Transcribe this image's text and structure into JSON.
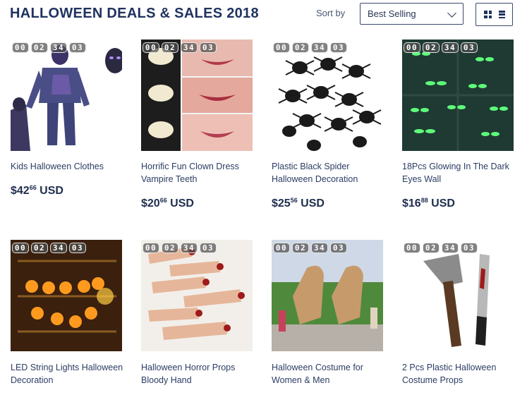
{
  "page": {
    "title": "HALLOWEEN DEALS & SALES 2018"
  },
  "sort": {
    "label": "Sort by",
    "selected": "Best Selling"
  },
  "icons": {
    "grid": "grid-view-icon",
    "list": "list-view-icon",
    "chevron": "chevron-down-icon"
  },
  "products": [
    {
      "name": "Kids Halloween Clothes",
      "price_whole": "$42",
      "price_cents": "66",
      "currency": "USD",
      "timer": [
        "00",
        "02",
        "34",
        "03"
      ],
      "image": "costume-image"
    },
    {
      "name": "Horrific Fun Clown Dress Vampire Teeth",
      "price_whole": "$20",
      "price_cents": "66",
      "currency": "USD",
      "timer": [
        "00",
        "02",
        "34",
        "03"
      ],
      "image": "vampire-teeth-image"
    },
    {
      "name": "Plastic Black Spider Halloween Decoration",
      "price_whole": "$25",
      "price_cents": "56",
      "currency": "USD",
      "timer": [
        "00",
        "02",
        "34",
        "03"
      ],
      "image": "spiders-image"
    },
    {
      "name": "18Pcs Glowing In The Dark Eyes Wall",
      "price_whole": "$16",
      "price_cents": "88",
      "currency": "USD",
      "timer": [
        "00",
        "02",
        "34",
        "03"
      ],
      "image": "glowing-eyes-image"
    },
    {
      "name": "LED String Lights Halloween Decoration",
      "timer": [
        "00",
        "02",
        "34",
        "03"
      ],
      "image": "pumpkin-lights-image"
    },
    {
      "name": "Halloween Horror Props Bloody Hand",
      "timer": [
        "00",
        "02",
        "34",
        "03"
      ],
      "image": "bloody-hands-image"
    },
    {
      "name": "Halloween Costume for Women & Men",
      "timer": [
        "00",
        "02",
        "34",
        "03"
      ],
      "image": "dinosaur-costume-image"
    },
    {
      "name": "2 Pcs Plastic Halloween Costume Props",
      "timer": [
        "00",
        "02",
        "34",
        "03"
      ],
      "image": "axe-knife-image"
    }
  ]
}
